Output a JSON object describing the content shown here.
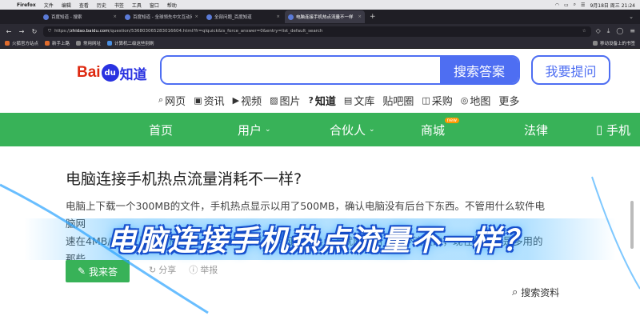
{
  "menubar": {
    "app": "Firefox",
    "items": [
      "文件",
      "编辑",
      "查看",
      "历史",
      "书签",
      "工具",
      "窗口",
      "帮助"
    ],
    "datetime": "9月18日 周三 21:24"
  },
  "tabs": [
    {
      "title": "百度知道 - 搜索",
      "active": false
    },
    {
      "title": "百度知道 - 全球领先中文互动问",
      "active": false
    },
    {
      "title": "全部问题_百度知道",
      "active": false
    },
    {
      "title": "电脑连接手机热点流量不一样",
      "active": true
    }
  ],
  "urlbar": {
    "url_prefix": "https://",
    "url_domain": "zhidao.baidu.com",
    "url_path": "/question/536803065283016604.html?fr=qlquick&is_force_answer=0&entry=list_default_search"
  },
  "bookmarks": [
    "火狐官方站点",
    "新手上路",
    "常用网址",
    "计算机二级这些别刷"
  ],
  "bookmarks_other": "移动设备上的书签",
  "logo": {
    "bai": "Bai",
    "du": "du",
    "zhidao": "知道"
  },
  "search": {
    "placeholder": "",
    "button": "搜索答案"
  },
  "ask_button": "我要提问",
  "channels": [
    {
      "icon": "⌕",
      "label": "网页"
    },
    {
      "icon": "▣",
      "label": "资讯"
    },
    {
      "icon": "▶",
      "label": "视频"
    },
    {
      "icon": "▨",
      "label": "图片"
    },
    {
      "icon": "?",
      "label": "知道",
      "active": true
    },
    {
      "icon": "▤",
      "label": "文库"
    },
    {
      "icon": "",
      "label": "贴吧圈"
    },
    {
      "icon": "◫",
      "label": "采购"
    },
    {
      "icon": "◎",
      "label": "地图"
    },
    {
      "icon": "",
      "label": "更多"
    }
  ],
  "greennav": {
    "home": "首页",
    "user": "用户",
    "partner": "合伙人",
    "mall": "商城",
    "mall_badge": "new",
    "law": "法律",
    "phone": "手机"
  },
  "question": {
    "title": "电脑连接手机热点流量消耗不一样?",
    "body_line1": "电脑上下载一个300MB的文件，手机热点显示以用了500MB，确认电脑没有后台下东西。不管用什么软件电脑网",
    "body_line2": "速在4MB/s手机上有10MB/s，本来电脑用了多少网手机热点上就应该用了多少流量的，现在的问题是多用的那些"
  },
  "banner_text": "电脑连接手机热点流量不一样？",
  "answer_button": "我来答",
  "actions": {
    "share": "分享",
    "report": "举报"
  },
  "search_data": "搜索资料",
  "colors": {
    "green": "#38b258",
    "blue": "#4e6ef2",
    "red": "#de2910"
  }
}
